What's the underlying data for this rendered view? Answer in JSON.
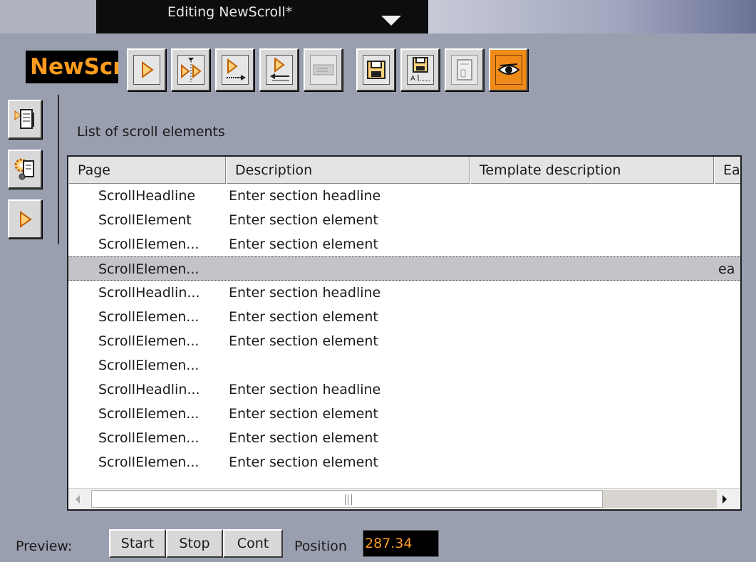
{
  "titlebar": {
    "title": "Editing NewScroll*"
  },
  "scene": {
    "name": "NewScroll"
  },
  "list": {
    "heading": "List of scroll elements",
    "columns": [
      "Page",
      "Description",
      "Template description",
      "Ea"
    ],
    "rows": [
      {
        "page": "ScrollHeadline",
        "description": "Enter section headline",
        "extra": ""
      },
      {
        "page": "ScrollElement",
        "description": "Enter section element",
        "extra": ""
      },
      {
        "page": "ScrollElemen...",
        "description": "Enter section element",
        "extra": ""
      },
      {
        "page": "ScrollElemen...",
        "description": "",
        "extra": "ea"
      },
      {
        "page": "ScrollHeadlin...",
        "description": "Enter section headline",
        "extra": ""
      },
      {
        "page": "ScrollElemen...",
        "description": "Enter section element",
        "extra": ""
      },
      {
        "page": "ScrollElemen...",
        "description": "Enter section element",
        "extra": ""
      },
      {
        "page": "ScrollElemen...",
        "description": "",
        "extra": ""
      },
      {
        "page": "ScrollHeadlin...",
        "description": "Enter section headline",
        "extra": ""
      },
      {
        "page": "ScrollElemen...",
        "description": "Enter section element",
        "extra": ""
      },
      {
        "page": "ScrollElemen...",
        "description": "Enter section element",
        "extra": ""
      },
      {
        "page": "ScrollElemen...",
        "description": "Enter section element",
        "extra": ""
      }
    ]
  },
  "preview": {
    "label": "Preview:",
    "start": "Start",
    "stop": "Stop",
    "cont": "Cont",
    "position_label": "Position",
    "position_value": "287.34"
  },
  "colors": {
    "accent": "#f08a18",
    "field_text": "#ff9c1e",
    "background": "#9a9fb0"
  }
}
